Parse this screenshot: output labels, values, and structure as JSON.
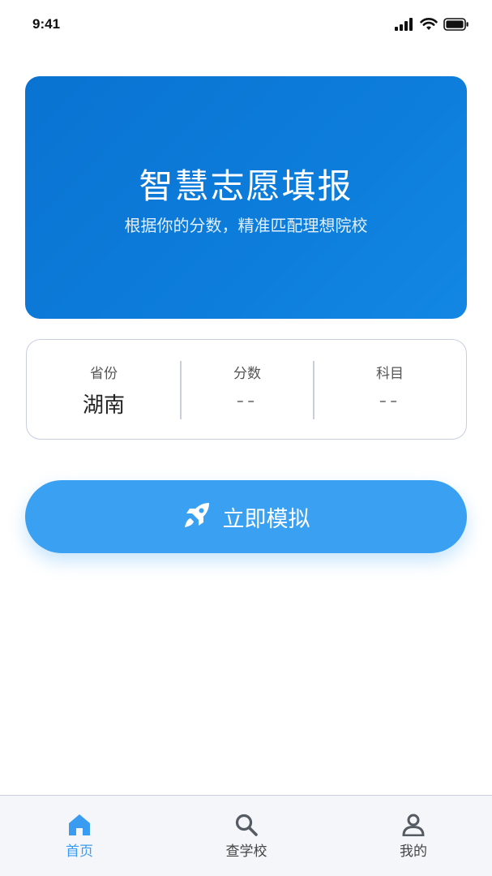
{
  "status_bar": {
    "time": "9:41",
    "icons": [
      "signal-icon",
      "wifi-icon",
      "battery-icon"
    ]
  },
  "hero": {
    "title": "智慧志愿填报",
    "subtitle": "根据你的分数，精准匹配理想院校",
    "background_color": "#0d7ddb"
  },
  "info_card": {
    "province": {
      "label": "省份",
      "value": "湖南"
    },
    "score": {
      "label": "分数",
      "value": "--"
    },
    "subject": {
      "label": "科目",
      "value": "--"
    }
  },
  "simulate_button": {
    "label": "立即模拟",
    "icon": "rocket-icon",
    "color": "#3aa0f2"
  },
  "tab_bar": {
    "tabs": [
      {
        "label": "首页",
        "icon": "home-icon",
        "active": true
      },
      {
        "label": "查学校",
        "icon": "search-icon",
        "active": false
      },
      {
        "label": "我的",
        "icon": "user-icon",
        "active": false
      }
    ],
    "active_color": "#3a9cf0",
    "inactive_color": "#555b63"
  }
}
